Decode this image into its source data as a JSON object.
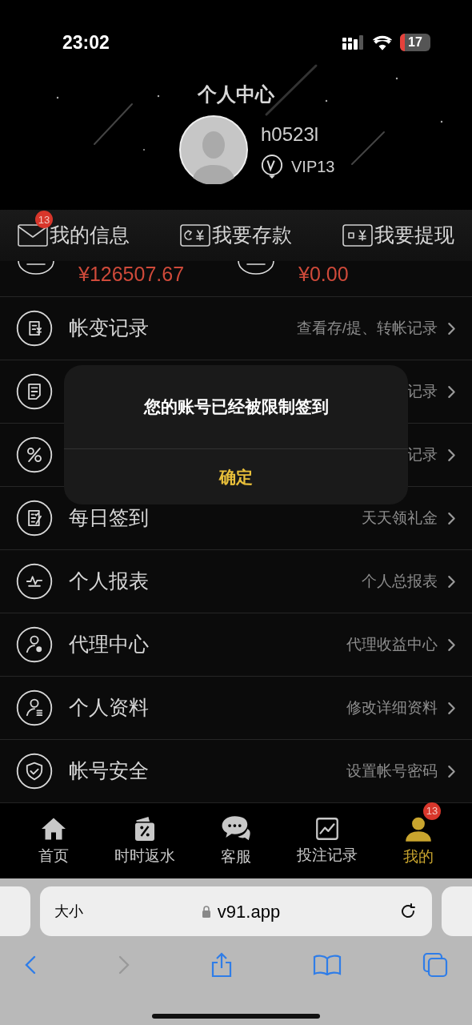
{
  "status_bar": {
    "time": "23:02",
    "battery": "17"
  },
  "header": {
    "title": "个人中心",
    "username": "h0523l",
    "vip": "VIP13"
  },
  "quick_actions": [
    {
      "label": "我的信息",
      "badge": "13"
    },
    {
      "label": "我要存款"
    },
    {
      "label": "我要提现"
    }
  ],
  "balances": [
    {
      "amount": "¥126507.67"
    },
    {
      "amount": "¥0.00"
    }
  ],
  "menu": [
    {
      "label": "帐变记录",
      "hint": "查看存/提、转帐记录"
    },
    {
      "hint": "记录"
    },
    {
      "hint": "记录"
    },
    {
      "label": "每日签到",
      "hint": "天天领礼金"
    },
    {
      "label": "个人报表",
      "hint": "个人总报表"
    },
    {
      "label": "代理中心",
      "hint": "代理收益中心"
    },
    {
      "label": "个人资料",
      "hint": "修改详细资料"
    },
    {
      "label": "帐号安全",
      "hint": "设置帐号密码"
    }
  ],
  "dialog": {
    "message": "您的账号已经被限制签到",
    "button": "确定"
  },
  "tab_bar": [
    {
      "label": "首页",
      "selected": false
    },
    {
      "label": "时时返水",
      "selected": false
    },
    {
      "label": "客服",
      "selected": false
    },
    {
      "label": "投注记录",
      "selected": false
    },
    {
      "label": "我的",
      "selected": true,
      "badge": "13"
    }
  ],
  "browser": {
    "text_size": "大小",
    "url": "v91.app"
  }
}
